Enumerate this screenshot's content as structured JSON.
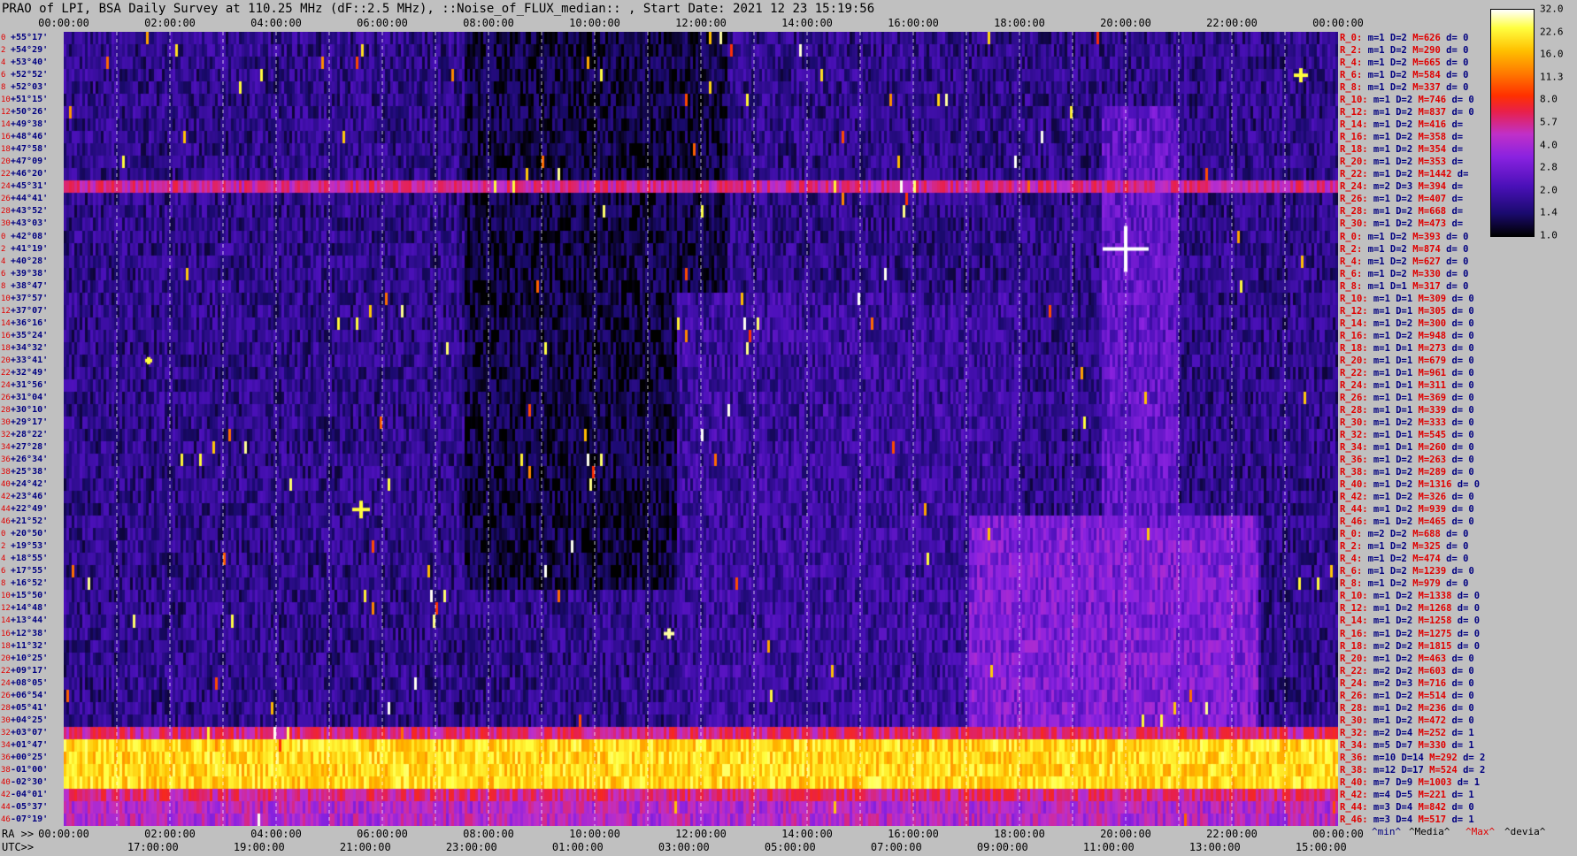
{
  "title": "PRAO of LPI, BSA Daily Survey at 110.25 MHz (dF::2.5 MHz), ::Noise_of_FLUX_median:: , Start Date: 2021 12 23 15:19:56",
  "top_ticks": [
    "00:00:00",
    "02:00:00",
    "04:00:00",
    "06:00:00",
    "08:00:00",
    "10:00:00",
    "12:00:00",
    "14:00:00",
    "16:00:00",
    "18:00:00",
    "20:00:00",
    "22:00:00",
    "00:00:00"
  ],
  "ra_axis_label": "RA >>",
  "ra_ticks": [
    "00:00:00",
    "02:00:00",
    "04:00:00",
    "06:00:00",
    "08:00:00",
    "10:00:00",
    "12:00:00",
    "14:00:00",
    "16:00:00",
    "18:00:00",
    "20:00:00",
    "22:00:00",
    "00:00:00"
  ],
  "utc_axis_label": "UTC>>",
  "utc_ticks": [
    "17:00:00",
    "19:00:00",
    "21:00:00",
    "23:00:00",
    "01:00:00",
    "03:00:00",
    "05:00:00",
    "07:00:00",
    "09:00:00",
    "11:00:00",
    "13:00:00",
    "15:00:00"
  ],
  "declinations": [
    "+55°17'",
    "+54°29'",
    "+53°40'",
    "+52°52'",
    "+52°03'",
    "+51°15'",
    "+50°26'",
    "+49°38'",
    "+48°46'",
    "+47°58'",
    "+47°09'",
    "+46°20'",
    "+45°31'",
    "+44°41'",
    "+43°52'",
    "+43°03'",
    "+42°08'",
    "+41°19'",
    "+40°28'",
    "+39°38'",
    "+38°47'",
    "+37°57'",
    "+37°07'",
    "+36°16'",
    "+35°24'",
    "+34°32'",
    "+33°41'",
    "+32°49'",
    "+31°56'",
    "+31°04'",
    "+30°10'",
    "+29°17'",
    "+28°22'",
    "+27°28'",
    "+26°34'",
    "+25°38'",
    "+24°42'",
    "+23°46'",
    "+22°49'",
    "+21°52'",
    "+20°50'",
    "+19°53'",
    "+18°55'",
    "+17°55'",
    "+16°52'",
    "+15°50'",
    "+14°48'",
    "+13°44'",
    "+12°38'",
    "+11°32'",
    "+10°25'",
    "+09°17'",
    "+08°05'",
    "+06°54'",
    "+05°41'",
    "+04°25'",
    "+03°07'",
    "+01°47'",
    "+00°25'",
    "-01°00'",
    "-02°30'",
    "-04°01'",
    "-05°37'",
    "-07°19'"
  ],
  "stats": [
    {
      "r": "R_0:",
      "m": "1",
      "D": "2",
      "M": "626",
      "d": "0"
    },
    {
      "r": "R_2:",
      "m": "1",
      "D": "2",
      "M": "290",
      "d": "0"
    },
    {
      "r": "R_4:",
      "m": "1",
      "D": "2",
      "M": "665",
      "d": "0"
    },
    {
      "r": "R_6:",
      "m": "1",
      "D": "2",
      "M": "584",
      "d": "0"
    },
    {
      "r": "R_8:",
      "m": "1",
      "D": "2",
      "M": "337",
      "d": "0"
    },
    {
      "r": "R_10:",
      "m": "1",
      "D": "2",
      "M": "746",
      "d": "0"
    },
    {
      "r": "R_12:",
      "m": "1",
      "D": "2",
      "M": "837",
      "d": "0"
    },
    {
      "r": "R_14:",
      "m": "1",
      "D": "2",
      "M": "416",
      "d": ""
    },
    {
      "r": "R_16:",
      "m": "1",
      "D": "2",
      "M": "358",
      "d": ""
    },
    {
      "r": "R_18:",
      "m": "1",
      "D": "2",
      "M": "354",
      "d": ""
    },
    {
      "r": "R_20:",
      "m": "1",
      "D": "2",
      "M": "353",
      "d": ""
    },
    {
      "r": "R_22:",
      "m": "1",
      "D": "2",
      "M": "1442",
      "d": ""
    },
    {
      "r": "R_24:",
      "m": "2",
      "D": "3",
      "M": "394",
      "d": ""
    },
    {
      "r": "R_26:",
      "m": "1",
      "D": "2",
      "M": "407",
      "d": ""
    },
    {
      "r": "R_28:",
      "m": "1",
      "D": "2",
      "M": "668",
      "d": ""
    },
    {
      "r": "R_30:",
      "m": "1",
      "D": "2",
      "M": "473",
      "d": ""
    },
    {
      "r": "R_0:",
      "m": "1",
      "D": "2",
      "M": "393",
      "d": "0"
    },
    {
      "r": "R_2:",
      "m": "1",
      "D": "2",
      "M": "874",
      "d": "0"
    },
    {
      "r": "R_4:",
      "m": "1",
      "D": "2",
      "M": "627",
      "d": "0"
    },
    {
      "r": "R_6:",
      "m": "1",
      "D": "2",
      "M": "330",
      "d": "0"
    },
    {
      "r": "R_8:",
      "m": "1",
      "D": "1",
      "M": "317",
      "d": "0"
    },
    {
      "r": "R_10:",
      "m": "1",
      "D": "1",
      "M": "309",
      "d": "0"
    },
    {
      "r": "R_12:",
      "m": "1",
      "D": "1",
      "M": "305",
      "d": "0"
    },
    {
      "r": "R_14:",
      "m": "1",
      "D": "2",
      "M": "300",
      "d": "0"
    },
    {
      "r": "R_16:",
      "m": "1",
      "D": "2",
      "M": "948",
      "d": "0"
    },
    {
      "r": "R_18:",
      "m": "1",
      "D": "1",
      "M": "273",
      "d": "0"
    },
    {
      "r": "R_20:",
      "m": "1",
      "D": "1",
      "M": "679",
      "d": "0"
    },
    {
      "r": "R_22:",
      "m": "1",
      "D": "1",
      "M": "961",
      "d": "0"
    },
    {
      "r": "R_24:",
      "m": "1",
      "D": "1",
      "M": "311",
      "d": "0"
    },
    {
      "r": "R_26:",
      "m": "1",
      "D": "1",
      "M": "369",
      "d": "0"
    },
    {
      "r": "R_28:",
      "m": "1",
      "D": "1",
      "M": "339",
      "d": "0"
    },
    {
      "r": "R_30:",
      "m": "1",
      "D": "2",
      "M": "333",
      "d": "0"
    },
    {
      "r": "R_32:",
      "m": "1",
      "D": "1",
      "M": "545",
      "d": "0"
    },
    {
      "r": "R_34:",
      "m": "1",
      "D": "1",
      "M": "260",
      "d": "0"
    },
    {
      "r": "R_36:",
      "m": "1",
      "D": "2",
      "M": "263",
      "d": "0"
    },
    {
      "r": "R_38:",
      "m": "1",
      "D": "2",
      "M": "289",
      "d": "0"
    },
    {
      "r": "R_40:",
      "m": "1",
      "D": "2",
      "M": "1316",
      "d": "0"
    },
    {
      "r": "R_42:",
      "m": "1",
      "D": "2",
      "M": "326",
      "d": "0"
    },
    {
      "r": "R_44:",
      "m": "1",
      "D": "2",
      "M": "939",
      "d": "0"
    },
    {
      "r": "R_46:",
      "m": "1",
      "D": "2",
      "M": "465",
      "d": "0"
    },
    {
      "r": "R_0:",
      "m": "2",
      "D": "2",
      "M": "688",
      "d": "0"
    },
    {
      "r": "R_2:",
      "m": "1",
      "D": "2",
      "M": "325",
      "d": "0"
    },
    {
      "r": "R_4:",
      "m": "1",
      "D": "2",
      "M": "474",
      "d": "0"
    },
    {
      "r": "R_6:",
      "m": "1",
      "D": "2",
      "M": "1239",
      "d": "0"
    },
    {
      "r": "R_8:",
      "m": "1",
      "D": "2",
      "M": "979",
      "d": "0"
    },
    {
      "r": "R_10:",
      "m": "1",
      "D": "2",
      "M": "1338",
      "d": "0"
    },
    {
      "r": "R_12:",
      "m": "1",
      "D": "2",
      "M": "1268",
      "d": "0"
    },
    {
      "r": "R_14:",
      "m": "1",
      "D": "2",
      "M": "1258",
      "d": "0"
    },
    {
      "r": "R_16:",
      "m": "1",
      "D": "2",
      "M": "1275",
      "d": "0"
    },
    {
      "r": "R_18:",
      "m": "2",
      "D": "2",
      "M": "1815",
      "d": "0"
    },
    {
      "r": "R_20:",
      "m": "1",
      "D": "2",
      "M": "463",
      "d": "0"
    },
    {
      "r": "R_22:",
      "m": "2",
      "D": "2",
      "M": "603",
      "d": "0"
    },
    {
      "r": "R_24:",
      "m": "2",
      "D": "3",
      "M": "716",
      "d": "0"
    },
    {
      "r": "R_26:",
      "m": "1",
      "D": "2",
      "M": "514",
      "d": "0"
    },
    {
      "r": "R_28:",
      "m": "1",
      "D": "2",
      "M": "236",
      "d": "0"
    },
    {
      "r": "R_30:",
      "m": "1",
      "D": "2",
      "M": "472",
      "d": "0"
    },
    {
      "r": "R_32:",
      "m": "2",
      "D": "4",
      "M": "252",
      "d": "1"
    },
    {
      "r": "R_34:",
      "m": "5",
      "D": "7",
      "M": "330",
      "d": "1"
    },
    {
      "r": "R_36:",
      "m": "10",
      "D": "14",
      "M": "292",
      "d": "2"
    },
    {
      "r": "R_38:",
      "m": "12",
      "D": "17",
      "M": "524",
      "d": "2"
    },
    {
      "r": "R_40:",
      "m": "7",
      "D": "9",
      "M": "1003",
      "d": "1"
    },
    {
      "r": "R_42:",
      "m": "4",
      "D": "5",
      "M": "221",
      "d": "1"
    },
    {
      "r": "R_44:",
      "m": "3",
      "D": "4",
      "M": "842",
      "d": "0"
    },
    {
      "r": "R_46:",
      "m": "3",
      "D": "4",
      "M": "517",
      "d": "1"
    }
  ],
  "legend_bottom": {
    "min": "^min^",
    "med": "^Media^",
    "max": "^Max^",
    "dev": "^devia^"
  },
  "colorbar": {
    "ticks": [
      "32.0",
      "22.6",
      "16.0",
      "11.3",
      "8.0",
      "5.7",
      "4.0",
      "2.8",
      "2.0",
      "1.4",
      "1.0"
    ]
  },
  "chart_data": {
    "type": "heatmap",
    "title": "PRAO of LPI, BSA Daily Survey at 110.25 MHz (dF::2.5 MHz), ::Noise_of_FLUX_median:: , Start Date: 2021 12 23 15:19:56",
    "x_axis_top": "RA",
    "xlim_hours": [
      0,
      24
    ],
    "y_axis": "declination",
    "rows": 64,
    "color_scale": "log",
    "colorbar_range": [
      1.0,
      32.0
    ],
    "features": [
      {
        "label": "bright horizontal band",
        "dec_range": [
          "+01°47'",
          "-02°30'"
        ],
        "level": 32
      },
      {
        "label": "bright line",
        "dec": "+45°31'",
        "level": 6
      },
      {
        "label": "source",
        "ra": "20:00",
        "dec": "+41°19'",
        "level": 32
      },
      {
        "label": "source",
        "ra": "23:30",
        "dec": "+52°03'",
        "level": 16
      },
      {
        "label": "source",
        "ra": "11:30",
        "dec": "+12°38'",
        "level": 16
      }
    ]
  }
}
